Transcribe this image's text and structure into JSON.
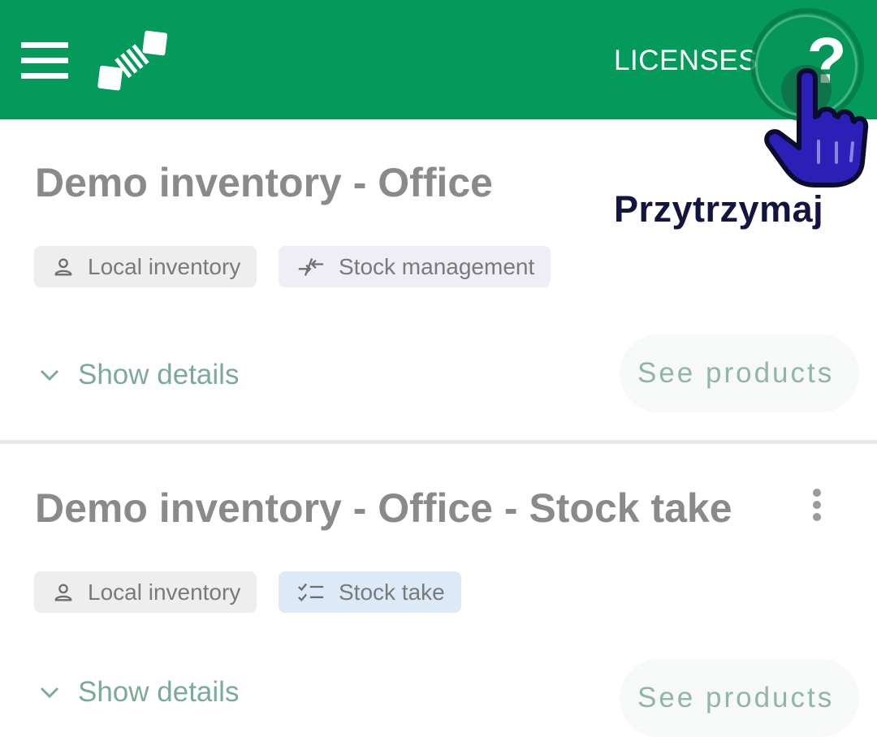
{
  "appbar": {
    "brand_color": "#039a5c",
    "menu_icon": "hamburger-menu-icon",
    "logo_icon": "barcode-tag-logo",
    "licenses_label": "LICENSES",
    "help_icon": "question-mark-icon",
    "help_glyph": "?"
  },
  "overlay": {
    "gesture_icon": "pointing-hand-icon",
    "hint_text": "Przytrzymaj"
  },
  "cards": [
    {
      "title": "Demo inventory - Office",
      "chips": [
        {
          "icon": "person-icon",
          "label": "Local inventory"
        },
        {
          "icon": "arrows-exchange-icon",
          "label": "Stock management"
        }
      ],
      "show_details_label": "Show details",
      "see_products_label": "See products"
    },
    {
      "title": "Demo inventory - Office - Stock take",
      "chips": [
        {
          "icon": "person-icon",
          "label": "Local inventory"
        },
        {
          "icon": "checklist-icon",
          "label": "Stock take"
        }
      ],
      "more_icon": "more-vertical-icon",
      "show_details_label": "Show details",
      "see_products_label": "See products"
    }
  ]
}
